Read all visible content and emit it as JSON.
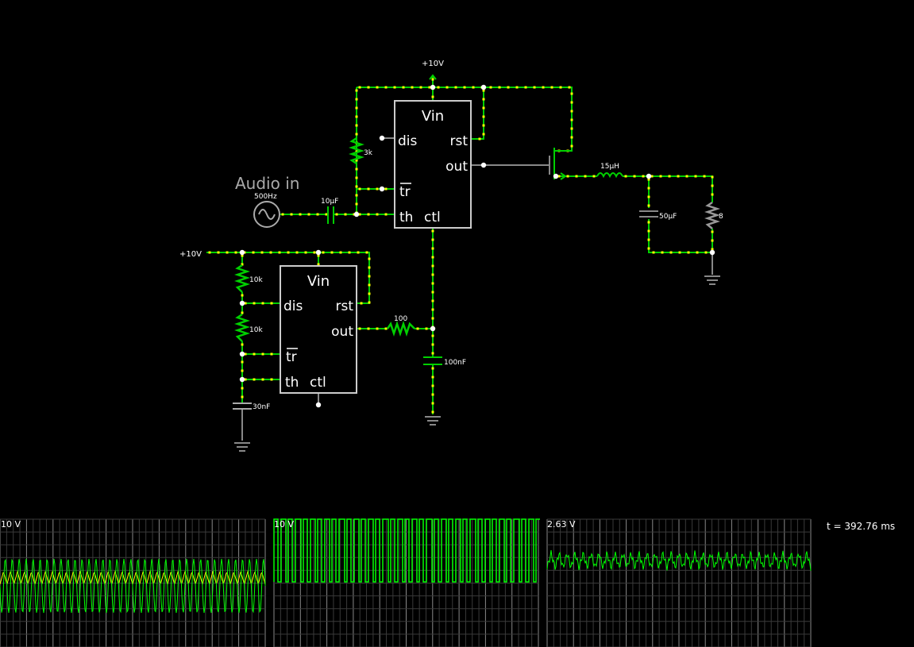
{
  "circuit": {
    "supply1": "+10V",
    "supply2": "+10V",
    "audio_label": "Audio in",
    "source_freq": "500Hz",
    "c_in": "10µF",
    "r_3k": "3k",
    "inductor": "15µH",
    "c_out": "50µF",
    "load": "8",
    "r_10k_a": "10k",
    "r_10k_b": "10k",
    "c_timing": "30nF",
    "r_100": "100",
    "c_100n": "100nF",
    "timer1": {
      "vin": "Vin",
      "dis": "dis",
      "rst": "rst",
      "out": "out",
      "tr": "tr",
      "th": "th",
      "ctl": "ctl"
    },
    "timer2": {
      "vin": "Vin",
      "dis": "dis",
      "rst": "rst",
      "out": "out",
      "tr": "tr",
      "th": "th",
      "ctl": "ctl"
    }
  },
  "scopes": [
    {
      "label": "10 V"
    },
    {
      "label": "10 V"
    },
    {
      "label": "2.63 V"
    }
  ],
  "time_readout": "t = 392.76 ms",
  "colors": {
    "live_wire": "#00d000",
    "current_dot": "#ffff00",
    "node": "#ffffff",
    "component": "#cccccc",
    "dead_wire": "#888888",
    "trace_green": "#00ff00",
    "trace_yellow": "#ffff00"
  }
}
